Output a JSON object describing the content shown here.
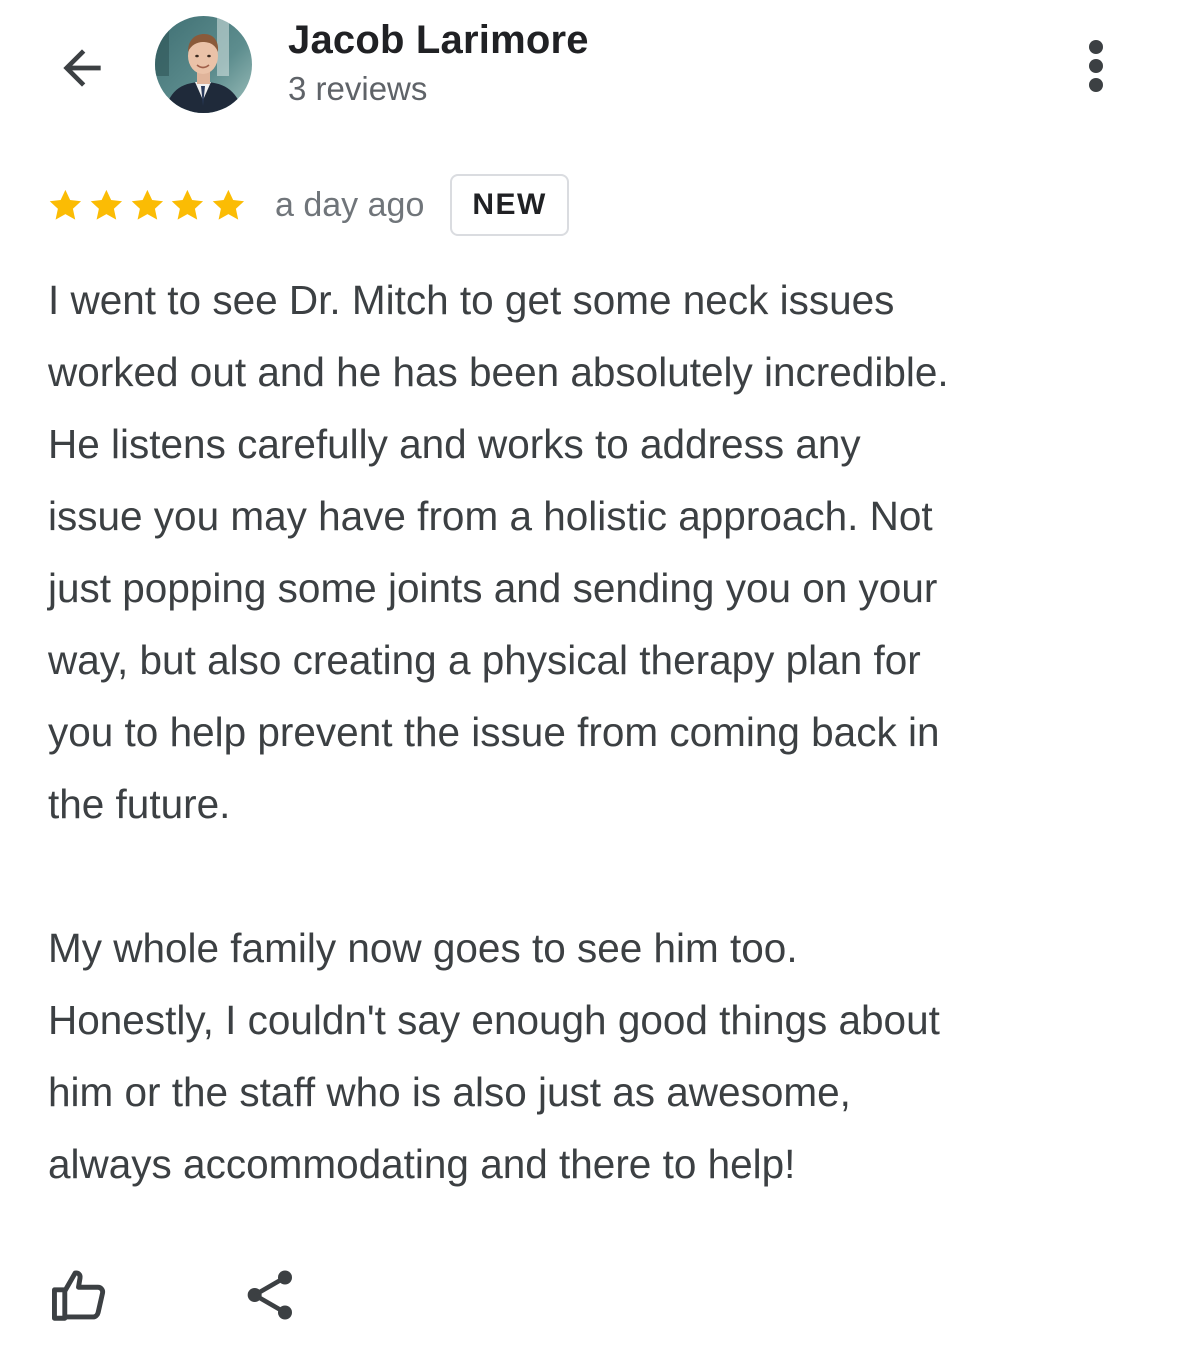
{
  "header": {
    "back_icon": "arrow-back-icon",
    "reviewer_name": "Jacob Larimore",
    "review_count": "3 reviews",
    "more_icon": "more-vert-icon"
  },
  "review": {
    "rating": 5,
    "rating_max": 5,
    "star_color": "#fbbc04",
    "time_ago": "a day ago",
    "badge": "NEW",
    "paragraphs": [
      "I went to see Dr. Mitch to get some neck issues\nworked out and he has been absolutely incredible.\nHe listens carefully and works to address any\nissue you may have from a holistic approach. Not\njust popping some joints and sending you on your\nway, but also creating a physical therapy plan for\nyou to help prevent the issue from coming back in\nthe future.",
      "My whole family now goes to see him too.\nHonestly, I couldn't say enough good things about\nhim or the staff who is also just as awesome,\nalways accommodating and there to help!"
    ]
  },
  "actions": {
    "like_icon": "thumb-up-icon",
    "share_icon": "share-icon"
  }
}
